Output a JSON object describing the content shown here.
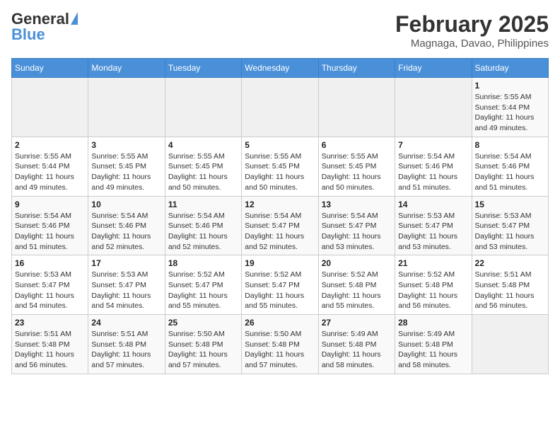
{
  "header": {
    "logo_general": "General",
    "logo_blue": "Blue",
    "month_year": "February 2025",
    "location": "Magnaga, Davao, Philippines"
  },
  "weekdays": [
    "Sunday",
    "Monday",
    "Tuesday",
    "Wednesday",
    "Thursday",
    "Friday",
    "Saturday"
  ],
  "weeks": [
    [
      {
        "day": "",
        "sunrise": "",
        "sunset": "",
        "daylight": "",
        "empty": true
      },
      {
        "day": "",
        "sunrise": "",
        "sunset": "",
        "daylight": "",
        "empty": true
      },
      {
        "day": "",
        "sunrise": "",
        "sunset": "",
        "daylight": "",
        "empty": true
      },
      {
        "day": "",
        "sunrise": "",
        "sunset": "",
        "daylight": "",
        "empty": true
      },
      {
        "day": "",
        "sunrise": "",
        "sunset": "",
        "daylight": "",
        "empty": true
      },
      {
        "day": "",
        "sunrise": "",
        "sunset": "",
        "daylight": "",
        "empty": true
      },
      {
        "day": "1",
        "sunrise": "Sunrise: 5:55 AM",
        "sunset": "Sunset: 5:44 PM",
        "daylight": "Daylight: 11 hours and 49 minutes.",
        "empty": false
      }
    ],
    [
      {
        "day": "2",
        "sunrise": "Sunrise: 5:55 AM",
        "sunset": "Sunset: 5:44 PM",
        "daylight": "Daylight: 11 hours and 49 minutes.",
        "empty": false
      },
      {
        "day": "3",
        "sunrise": "Sunrise: 5:55 AM",
        "sunset": "Sunset: 5:45 PM",
        "daylight": "Daylight: 11 hours and 49 minutes.",
        "empty": false
      },
      {
        "day": "4",
        "sunrise": "Sunrise: 5:55 AM",
        "sunset": "Sunset: 5:45 PM",
        "daylight": "Daylight: 11 hours and 50 minutes.",
        "empty": false
      },
      {
        "day": "5",
        "sunrise": "Sunrise: 5:55 AM",
        "sunset": "Sunset: 5:45 PM",
        "daylight": "Daylight: 11 hours and 50 minutes.",
        "empty": false
      },
      {
        "day": "6",
        "sunrise": "Sunrise: 5:55 AM",
        "sunset": "Sunset: 5:45 PM",
        "daylight": "Daylight: 11 hours and 50 minutes.",
        "empty": false
      },
      {
        "day": "7",
        "sunrise": "Sunrise: 5:54 AM",
        "sunset": "Sunset: 5:46 PM",
        "daylight": "Daylight: 11 hours and 51 minutes.",
        "empty": false
      },
      {
        "day": "8",
        "sunrise": "Sunrise: 5:54 AM",
        "sunset": "Sunset: 5:46 PM",
        "daylight": "Daylight: 11 hours and 51 minutes.",
        "empty": false
      }
    ],
    [
      {
        "day": "9",
        "sunrise": "Sunrise: 5:54 AM",
        "sunset": "Sunset: 5:46 PM",
        "daylight": "Daylight: 11 hours and 51 minutes.",
        "empty": false
      },
      {
        "day": "10",
        "sunrise": "Sunrise: 5:54 AM",
        "sunset": "Sunset: 5:46 PM",
        "daylight": "Daylight: 11 hours and 52 minutes.",
        "empty": false
      },
      {
        "day": "11",
        "sunrise": "Sunrise: 5:54 AM",
        "sunset": "Sunset: 5:46 PM",
        "daylight": "Daylight: 11 hours and 52 minutes.",
        "empty": false
      },
      {
        "day": "12",
        "sunrise": "Sunrise: 5:54 AM",
        "sunset": "Sunset: 5:47 PM",
        "daylight": "Daylight: 11 hours and 52 minutes.",
        "empty": false
      },
      {
        "day": "13",
        "sunrise": "Sunrise: 5:54 AM",
        "sunset": "Sunset: 5:47 PM",
        "daylight": "Daylight: 11 hours and 53 minutes.",
        "empty": false
      },
      {
        "day": "14",
        "sunrise": "Sunrise: 5:53 AM",
        "sunset": "Sunset: 5:47 PM",
        "daylight": "Daylight: 11 hours and 53 minutes.",
        "empty": false
      },
      {
        "day": "15",
        "sunrise": "Sunrise: 5:53 AM",
        "sunset": "Sunset: 5:47 PM",
        "daylight": "Daylight: 11 hours and 53 minutes.",
        "empty": false
      }
    ],
    [
      {
        "day": "16",
        "sunrise": "Sunrise: 5:53 AM",
        "sunset": "Sunset: 5:47 PM",
        "daylight": "Daylight: 11 hours and 54 minutes.",
        "empty": false
      },
      {
        "day": "17",
        "sunrise": "Sunrise: 5:53 AM",
        "sunset": "Sunset: 5:47 PM",
        "daylight": "Daylight: 11 hours and 54 minutes.",
        "empty": false
      },
      {
        "day": "18",
        "sunrise": "Sunrise: 5:52 AM",
        "sunset": "Sunset: 5:47 PM",
        "daylight": "Daylight: 11 hours and 55 minutes.",
        "empty": false
      },
      {
        "day": "19",
        "sunrise": "Sunrise: 5:52 AM",
        "sunset": "Sunset: 5:47 PM",
        "daylight": "Daylight: 11 hours and 55 minutes.",
        "empty": false
      },
      {
        "day": "20",
        "sunrise": "Sunrise: 5:52 AM",
        "sunset": "Sunset: 5:48 PM",
        "daylight": "Daylight: 11 hours and 55 minutes.",
        "empty": false
      },
      {
        "day": "21",
        "sunrise": "Sunrise: 5:52 AM",
        "sunset": "Sunset: 5:48 PM",
        "daylight": "Daylight: 11 hours and 56 minutes.",
        "empty": false
      },
      {
        "day": "22",
        "sunrise": "Sunrise: 5:51 AM",
        "sunset": "Sunset: 5:48 PM",
        "daylight": "Daylight: 11 hours and 56 minutes.",
        "empty": false
      }
    ],
    [
      {
        "day": "23",
        "sunrise": "Sunrise: 5:51 AM",
        "sunset": "Sunset: 5:48 PM",
        "daylight": "Daylight: 11 hours and 56 minutes.",
        "empty": false
      },
      {
        "day": "24",
        "sunrise": "Sunrise: 5:51 AM",
        "sunset": "Sunset: 5:48 PM",
        "daylight": "Daylight: 11 hours and 57 minutes.",
        "empty": false
      },
      {
        "day": "25",
        "sunrise": "Sunrise: 5:50 AM",
        "sunset": "Sunset: 5:48 PM",
        "daylight": "Daylight: 11 hours and 57 minutes.",
        "empty": false
      },
      {
        "day": "26",
        "sunrise": "Sunrise: 5:50 AM",
        "sunset": "Sunset: 5:48 PM",
        "daylight": "Daylight: 11 hours and 57 minutes.",
        "empty": false
      },
      {
        "day": "27",
        "sunrise": "Sunrise: 5:49 AM",
        "sunset": "Sunset: 5:48 PM",
        "daylight": "Daylight: 11 hours and 58 minutes.",
        "empty": false
      },
      {
        "day": "28",
        "sunrise": "Sunrise: 5:49 AM",
        "sunset": "Sunset: 5:48 PM",
        "daylight": "Daylight: 11 hours and 58 minutes.",
        "empty": false
      },
      {
        "day": "",
        "sunrise": "",
        "sunset": "",
        "daylight": "",
        "empty": true
      }
    ]
  ]
}
